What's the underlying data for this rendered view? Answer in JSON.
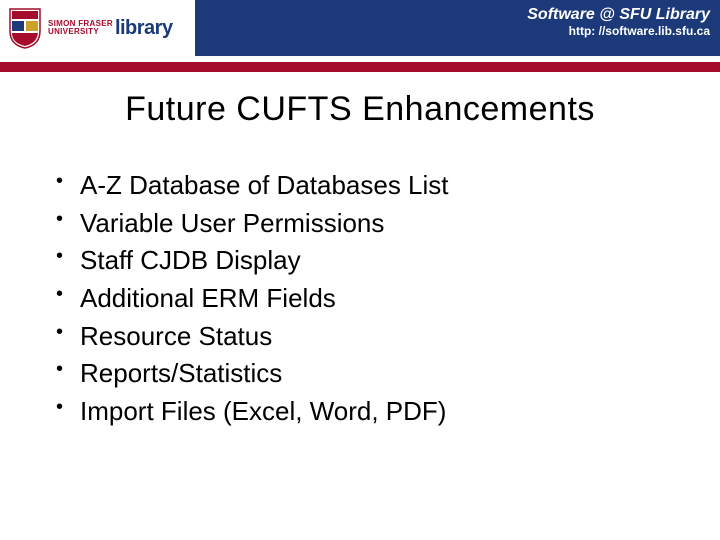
{
  "header": {
    "org_line1": "SIMON FRASER",
    "org_line2": "UNIVERSITY",
    "library_word": "library",
    "software_title": "Software @ SFU Library",
    "url": "http: //software.lib.sfu.ca"
  },
  "slide": {
    "title": "Future CUFTS Enhancements",
    "bullets": [
      "A-Z Database of Databases List",
      "Variable User Permissions",
      "Staff CJDB Display",
      "Additional ERM Fields",
      "Resource Status",
      "Reports/Statistics",
      "Import Files (Excel, Word, PDF)"
    ]
  }
}
